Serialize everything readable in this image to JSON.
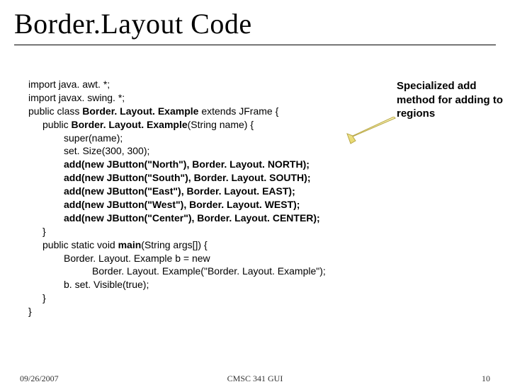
{
  "title": "Border.Layout Code",
  "callout": "Specialized add method for adding to regions",
  "code": {
    "l1": "import java. awt. *;",
    "l2": "import javax. swing. *;",
    "l3a": "public class ",
    "l3b": "Border. Layout. Example",
    "l3c": " extends JFrame {",
    "l4a": "public ",
    "l4b": "Border. Layout. Example",
    "l4c": "(String name) {",
    "l5": "super(name);",
    "l6": "set. Size(300, 300);",
    "l7": "add(new JButton(\"North\"), Border. Layout. NORTH);",
    "l8": "add(new JButton(\"South\"), Border. Layout. SOUTH);",
    "l9": "add(new JButton(\"East\"), Border. Layout. EAST);",
    "l10": "add(new JButton(\"West\"), Border. Layout. WEST);",
    "l11": "add(new JButton(\"Center\"), Border. Layout. CENTER);",
    "l12": "}",
    "l13a": "public static void ",
    "l13b": "main",
    "l13c": "(String args[]) {",
    "l14": "Border. Layout. Example b = new",
    "l15": "Border. Layout. Example(\"Border. Layout. Example\");",
    "l16": "b. set. Visible(true);",
    "l17": "}",
    "l18": "}"
  },
  "footer": {
    "date": "09/26/2007",
    "center": "CMSC 341 GUI",
    "page": "10"
  }
}
